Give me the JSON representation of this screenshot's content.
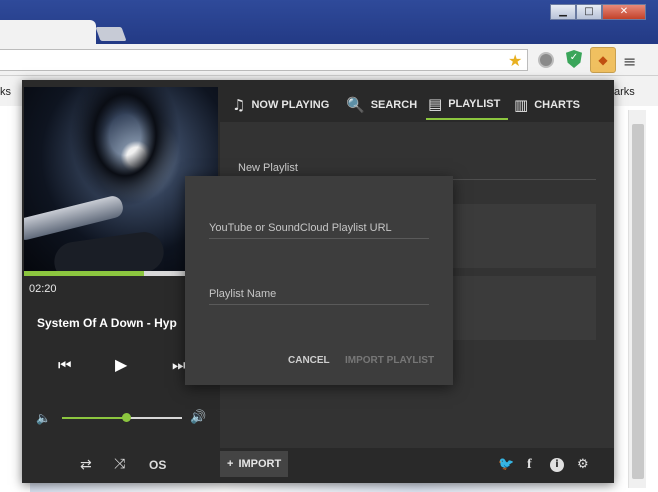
{
  "browser": {
    "window_controls": [
      "minimize",
      "maximize",
      "close"
    ],
    "bookmarks_left": "ks",
    "bookmarks_right": "arks"
  },
  "popup": {
    "nav": {
      "tabs": [
        {
          "label": "NOW PLAYING",
          "icon": "music-note-icon"
        },
        {
          "label": "SEARCH",
          "icon": "search-icon"
        },
        {
          "label": "PLAYLIST",
          "icon": "playlist-icon"
        },
        {
          "label": "CHARTS",
          "icon": "charts-icon"
        }
      ],
      "active": "PLAYLIST"
    },
    "new_playlist_label": "New Playlist",
    "player": {
      "time": "02:20",
      "track_title": "System Of A Down - Hyp",
      "progress": 0.62,
      "volume": 0.53
    },
    "footer": {
      "import_label": "IMPORT",
      "icons": [
        "twitter-icon",
        "facebook-icon",
        "info-icon",
        "settings-icon"
      ]
    },
    "modal": {
      "url_placeholder": "YouTube or SoundCloud Playlist URL",
      "name_placeholder": "Playlist Name",
      "cancel_label": "CANCEL",
      "import_playlist_label": "IMPORT PLAYLIST"
    }
  },
  "colors": {
    "accent": "#8cc63f",
    "panel": "#333333",
    "navbar": "#292929"
  }
}
